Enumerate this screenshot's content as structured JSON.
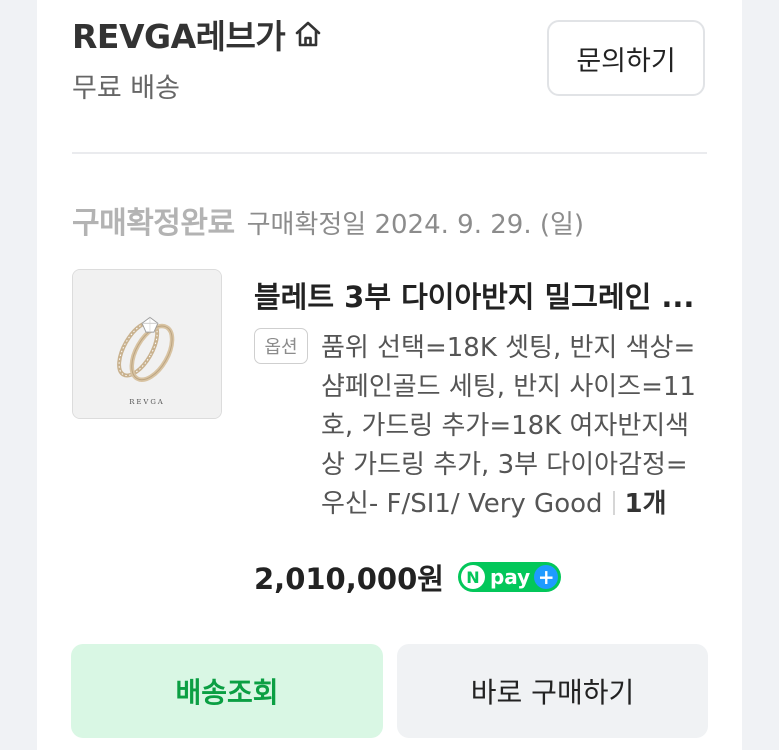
{
  "store": {
    "name": "REVGA레브가",
    "home_icon": "home-icon",
    "shipping": "무료 배송",
    "inquiry_label": "문의하기"
  },
  "order": {
    "status": "구매확정완료",
    "confirm_date": "구매확정일 2024. 9. 29. (일)"
  },
  "product": {
    "title": "블레트 3부 다이아반지 밀그레인 ...",
    "thumbnail_logo": "REVGA",
    "option_badge": "옵션",
    "option_lines": [
      "품위 선택=18K 셋팅, 반지 색상=",
      "샴페인골드 세팅, 반지 사이즈=11",
      "호, 가드링 추가=18K 여자반지색",
      "상 가드링 추가, 3부 다이아감정=",
      "우신- F/SI1/ Very Good"
    ],
    "quantity": "1개",
    "price": "2,010,000원",
    "npay": {
      "n": "N",
      "text": "pay",
      "plus": "+"
    }
  },
  "actions": {
    "track_label": "배송조회",
    "buy_again_label": "바로 구매하기"
  },
  "colors": {
    "accent_green": "#03c75a",
    "track_text": "#0b9f43",
    "track_bg": "#d9f7e4",
    "npay_plus": "#1e9bff"
  }
}
